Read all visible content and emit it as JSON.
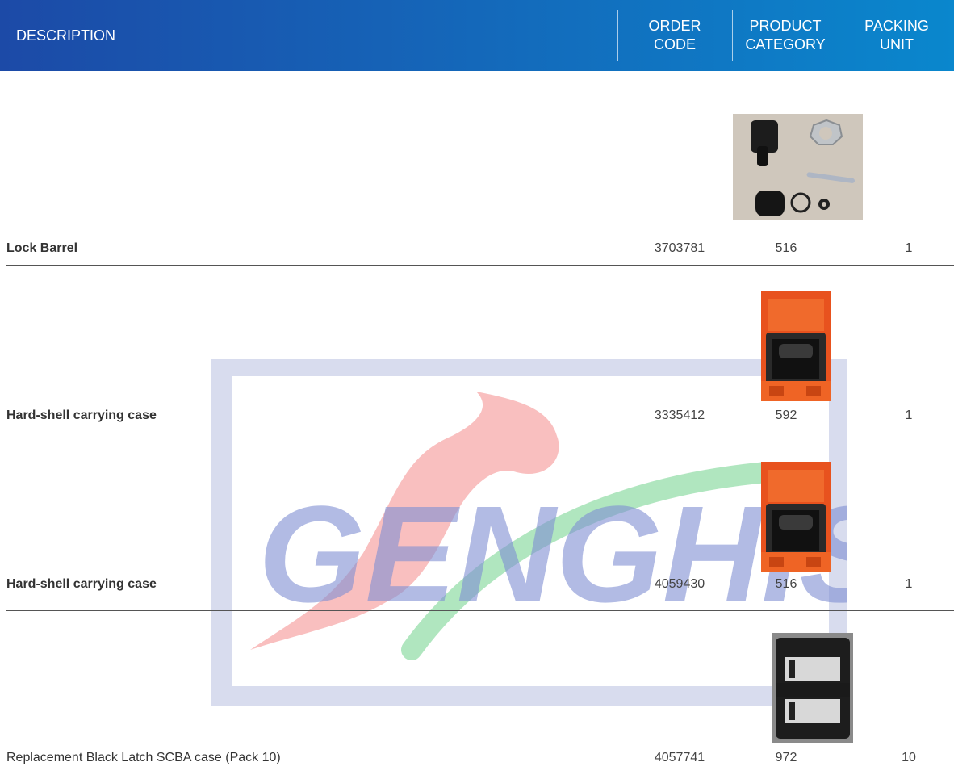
{
  "header": {
    "description": "DESCRIPTION",
    "order_code": [
      "ORDER",
      "CODE"
    ],
    "product_category": [
      "PRODUCT",
      "CATEGORY"
    ],
    "packing_unit": [
      "PACKING",
      "UNIT"
    ],
    "colors": {
      "start": "#1c4aa7",
      "end": "#0a87cd"
    }
  },
  "watermark": {
    "text": "GENGHIS"
  },
  "rows": [
    {
      "description": "Lock Barrel",
      "order_code": "3703781",
      "product_category": "516",
      "packing_unit": "1",
      "image": "lock-barrel-parts-photo"
    },
    {
      "description": "Hard-shell carrying case",
      "order_code": "3335412",
      "product_category": "592",
      "packing_unit": "1",
      "image": "orange-case-photo"
    },
    {
      "description": "Hard-shell carrying case",
      "order_code": "4059430",
      "product_category": "516",
      "packing_unit": "1",
      "image": "orange-case-photo"
    },
    {
      "description": "Replacement Black Latch SCBA case (Pack 10)",
      "order_code": "4057741",
      "product_category": "972",
      "packing_unit": "10",
      "image": "black-latch-photo"
    }
  ]
}
